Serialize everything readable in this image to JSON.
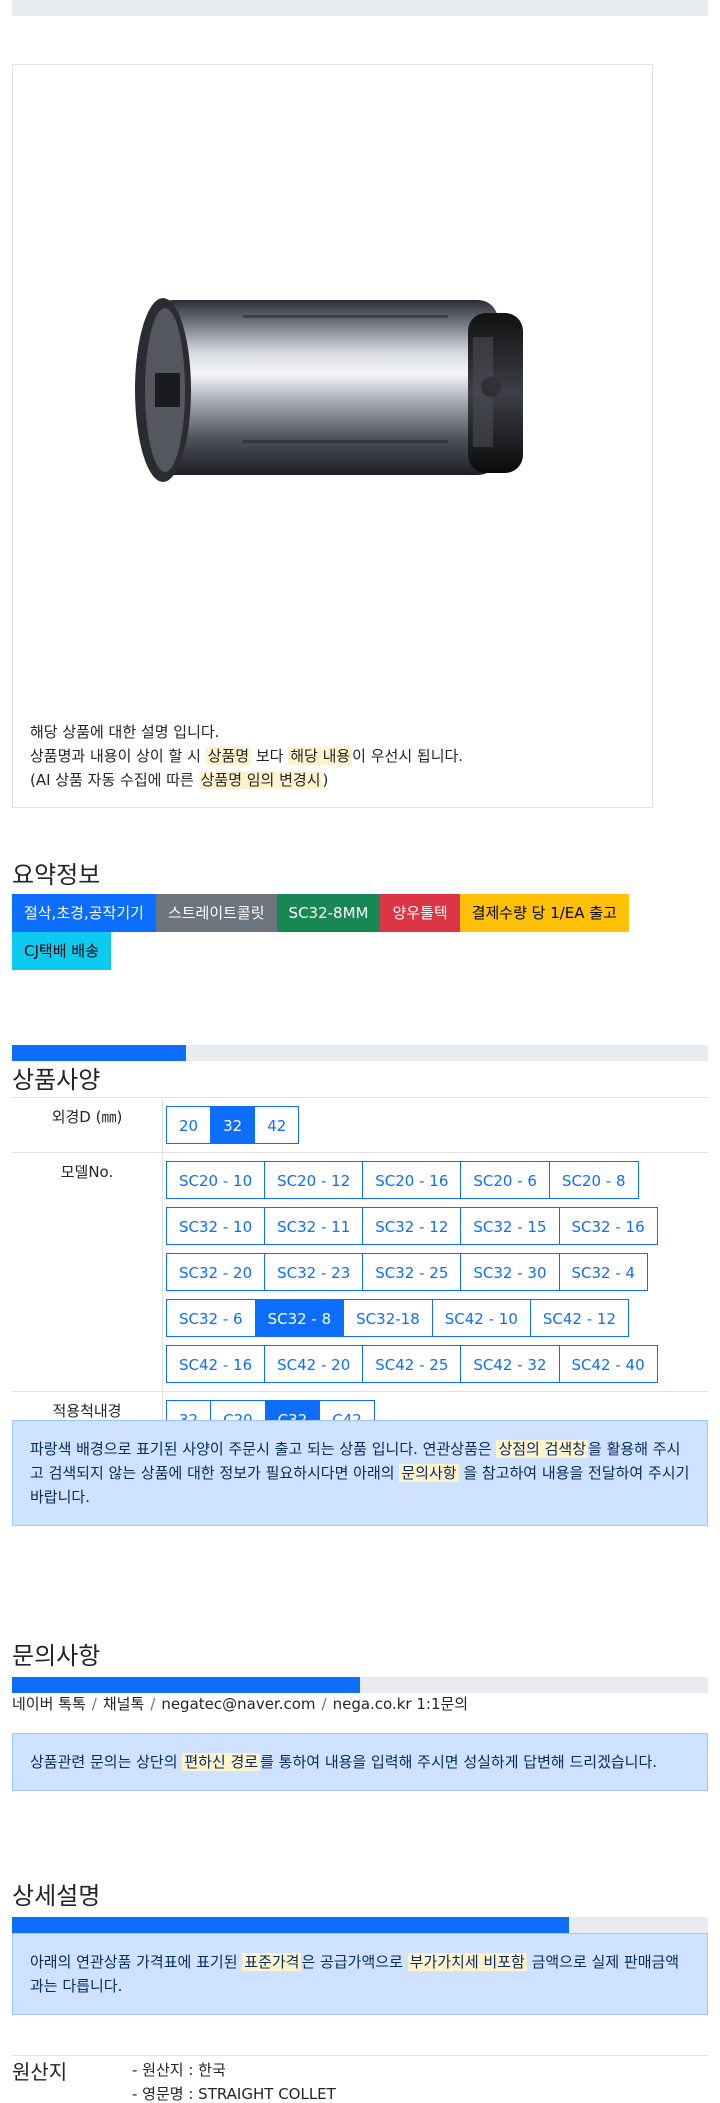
{
  "product": {
    "description_line1": "해당 상품에 대한 설명 입니다.",
    "description_line2": {
      "pre": "상품명과 내용이 상이 할 시 ",
      "hl1": "상품명",
      "mid": " 보다 ",
      "hl2": "해당 내용",
      "post": "이 우선시 됩니다."
    },
    "description_line3": {
      "pre": "(AI 상품 자동 수집에 따른 ",
      "hl": "상품명 임의 변경시",
      "post": ")"
    }
  },
  "summary": {
    "title": "요약정보",
    "tags": [
      {
        "label": "절삭,초경,공작기기",
        "color": "#0d6efd"
      },
      {
        "label": "스트레이트콜릿",
        "color": "#6c757d"
      },
      {
        "label": "SC32-8MM",
        "color": "#198754"
      },
      {
        "label": "양우툴텍",
        "color": "#dc3545"
      },
      {
        "label": "결제수량 당 1/EA 출고",
        "color": "#ffc107"
      },
      {
        "label": "CJ택배 배송",
        "color": "#0dcaf0"
      }
    ]
  },
  "spec": {
    "title": "상품사양",
    "progress": 0.25,
    "rows": [
      {
        "label": "외경D (㎜)",
        "options": [
          "20",
          "32",
          "42"
        ],
        "active": "32"
      },
      {
        "label": "모델No.",
        "options": [
          "SC20 - 10",
          "SC20 - 12",
          "SC20 - 16",
          "SC20 - 6",
          "SC20 - 8",
          "SC32 - 10",
          "SC32 - 11",
          "SC32 - 12",
          "SC32 - 15",
          "SC32 - 16",
          "SC32 - 20",
          "SC32 - 23",
          "SC32 - 25",
          "SC32 - 30",
          "SC32 - 4",
          "SC32 - 6",
          "SC32 - 8",
          "SC32-18",
          "SC42 - 10",
          "SC42 - 12",
          "SC42 - 16",
          "SC42 - 20",
          "SC42 - 25",
          "SC42 - 32",
          "SC42 - 40"
        ],
        "active": "SC32 - 8"
      },
      {
        "label": "적용척내경",
        "options": [
          "32",
          "C20",
          "C32",
          "C42"
        ],
        "active": "C32"
      }
    ],
    "notice": {
      "pre": "파랑색 배경으로 표기된 사양이 주문시 출고 되는 상품 입니다. 연관상품은 ",
      "hl1": "상점의 검색창",
      "mid": "을 활용해 주시고 검색되지 않는 상품에 대한 정보가 필요하시다면 아래의 ",
      "hl2": "문의사항",
      "post": " 을 참고하여 내용을 전달하여 주시기 바랍니다."
    }
  },
  "inquiry": {
    "title": "문의사항",
    "progress": 0.5,
    "links": [
      "네이버 톡톡",
      "채널톡",
      "negatec@naver.com",
      "nega.co.kr 1:1문의"
    ],
    "separator": "/",
    "notice": {
      "pre": "상품관련 문의는 상단의 ",
      "hl": "편하신 경로",
      "post": "를 통하여 내용을 입력해 주시면 성실하게 답변해 드리겠습니다."
    }
  },
  "detail": {
    "title": "상세설명",
    "progress": 0.8,
    "notice": {
      "pre": "아래의 연관상품 가격표에 표기된 ",
      "hl1": "표준가격",
      "mid": "은 공급가액으로 ",
      "hl2": "부가가치세 비포함",
      "post": " 금액으로 실제 판매금액과는 다릅니다."
    }
  },
  "origin": {
    "label": "원산지",
    "items": [
      "- 원산지 : 한국",
      "- 영문명 : STRAIGHT COLLET"
    ]
  }
}
